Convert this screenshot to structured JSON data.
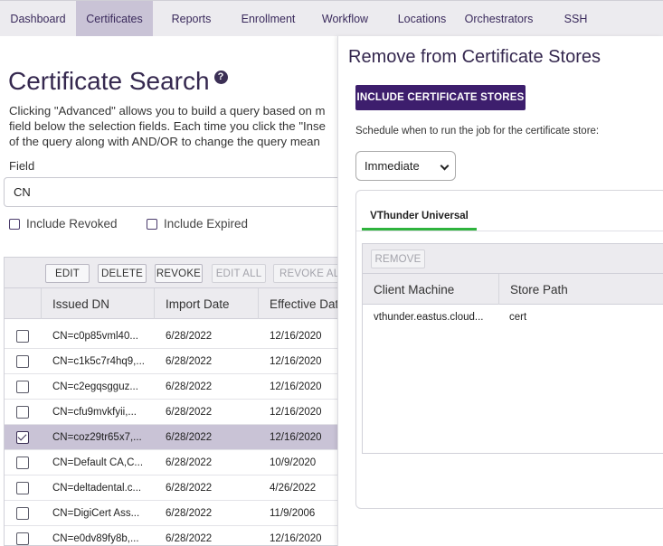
{
  "nav": {
    "tabs": [
      {
        "label": "Dashboard"
      },
      {
        "label": "Certificates"
      },
      {
        "label": "Reports"
      },
      {
        "label": "Enrollment"
      },
      {
        "label": "Workflow"
      },
      {
        "label": "Locations"
      },
      {
        "label": "Orchestrators"
      },
      {
        "label": "SSH"
      }
    ],
    "active_tab": "Certificates"
  },
  "search": {
    "title": "Certificate Search",
    "help_icon": "?",
    "description_lines": [
      "Clicking \"Advanced\" allows you to build a query based on m",
      "field below the selection fields. Each time you click the \"Inse",
      "of the query along with AND/OR to change the query mean"
    ],
    "field_label": "Field",
    "field_value": "CN",
    "include_revoked_label": "Include Revoked",
    "include_expired_label": "Include Expired"
  },
  "grid": {
    "toolbar": {
      "edit": "EDIT",
      "delete": "DELETE",
      "revoke": "REVOKE",
      "edit_all": "EDIT ALL",
      "revoke_all": "REVOKE AL"
    },
    "columns": {
      "issued_dn": "Issued DN",
      "import_date": "Import Date",
      "effective_date": "Effective Dat"
    },
    "rows": [
      {
        "issued_dn": "CN=c0p85vml40...",
        "import_date": "6/28/2022",
        "effective_date": "12/16/2020",
        "selected": false
      },
      {
        "issued_dn": "CN=c1k5c7r4hq9,...",
        "import_date": "6/28/2022",
        "effective_date": "12/16/2020",
        "selected": false
      },
      {
        "issued_dn": "CN=c2egqsgguz...",
        "import_date": "6/28/2022",
        "effective_date": "12/16/2020",
        "selected": false
      },
      {
        "issued_dn": "CN=cfu9mvkfyii,...",
        "import_date": "6/28/2022",
        "effective_date": "12/16/2020",
        "selected": false
      },
      {
        "issued_dn": "CN=coz29tr65x7,...",
        "import_date": "6/28/2022",
        "effective_date": "12/16/2020",
        "selected": true
      },
      {
        "issued_dn": "CN=Default CA,C...",
        "import_date": "6/28/2022",
        "effective_date": "10/9/2020",
        "selected": false
      },
      {
        "issued_dn": "CN=deltadental.c...",
        "import_date": "6/28/2022",
        "effective_date": "4/26/2022",
        "selected": false
      },
      {
        "issued_dn": "CN=DigiCert Ass...",
        "import_date": "6/28/2022",
        "effective_date": "11/9/2006",
        "selected": false
      },
      {
        "issued_dn": "CN=e0dv89fy8b,...",
        "import_date": "6/28/2022",
        "effective_date": "12/16/2020",
        "selected": false
      }
    ]
  },
  "panel": {
    "title": "Remove from Certificate Stores",
    "include_button": "INCLUDE CERTIFICATE STORES",
    "schedule_label": "Schedule when to run the job for the certificate store:",
    "schedule_value": "Immediate",
    "store_tab": "VThunder Universal",
    "remove_button": "REMOVE",
    "columns": {
      "client_machine": "Client Machine",
      "store_path": "Store Path"
    },
    "rows": [
      {
        "client_machine": "vthunder.eastus.cloud...",
        "store_path": "cert"
      }
    ]
  },
  "colors": {
    "brand_purple": "#3d1e6d",
    "selected_row": "#c9c3d6",
    "tab_underline": "#2fb33d"
  }
}
